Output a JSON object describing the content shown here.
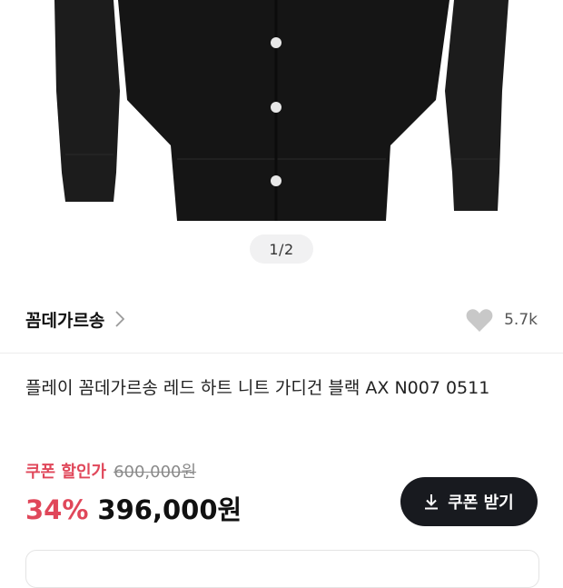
{
  "gallery": {
    "image_alt": "black cardigan",
    "indicator": "1/2"
  },
  "brand": {
    "name": "꼼데가르송",
    "chevron_icon": "chevron-right-icon",
    "like_icon": "heart-icon",
    "like_count": "5.7k"
  },
  "product": {
    "title": "플레이 꼼데가르송 레드 하트 니트 가디건 블랙 AX N007 0511"
  },
  "pricing": {
    "coupon_label": "쿠폰 할인가",
    "original_price": "600,000원",
    "discount_rate": "34%",
    "final_price": "396,000원"
  },
  "coupon_button": {
    "icon": "download-icon",
    "label": "쿠폰 받기"
  },
  "colors": {
    "accent_red": "#e0475a",
    "button_dark": "#181a1f",
    "heart_gray": "#c8c8c8"
  }
}
